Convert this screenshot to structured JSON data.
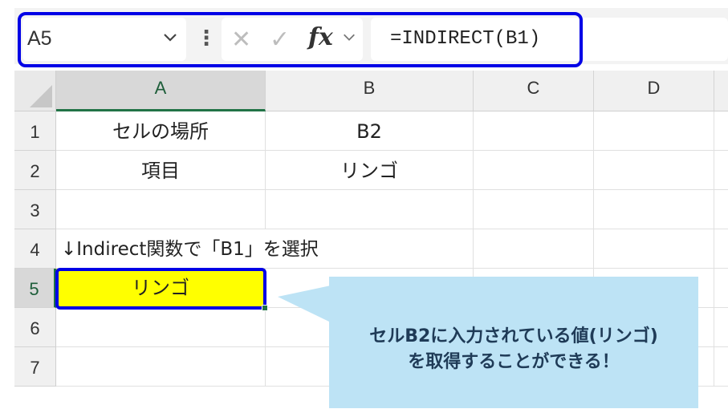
{
  "formula_bar": {
    "name_box": "A5",
    "cancel_glyph": "✕",
    "enter_glyph": "✓",
    "fx_label": "fx",
    "formula": "=INDIRECT(B1)"
  },
  "columns": [
    "A",
    "B",
    "C",
    "D"
  ],
  "rows": [
    "1",
    "2",
    "3",
    "4",
    "5",
    "6",
    "7"
  ],
  "cells": {
    "A1": "セルの場所",
    "B1": "B2",
    "A2": "項目",
    "B2": "リンゴ",
    "A4": "↓Indirect関数で「B1」を選択",
    "A5": "リンゴ"
  },
  "callout": {
    "line1": "セルB2に入力されている値(リンゴ)",
    "line2": "を取得することができる！"
  },
  "colors": {
    "highlight_outline": "#0000e6",
    "selected_cell_fill": "#ffff00",
    "callout_fill": "#bde3f5",
    "excel_green": "#217346"
  }
}
